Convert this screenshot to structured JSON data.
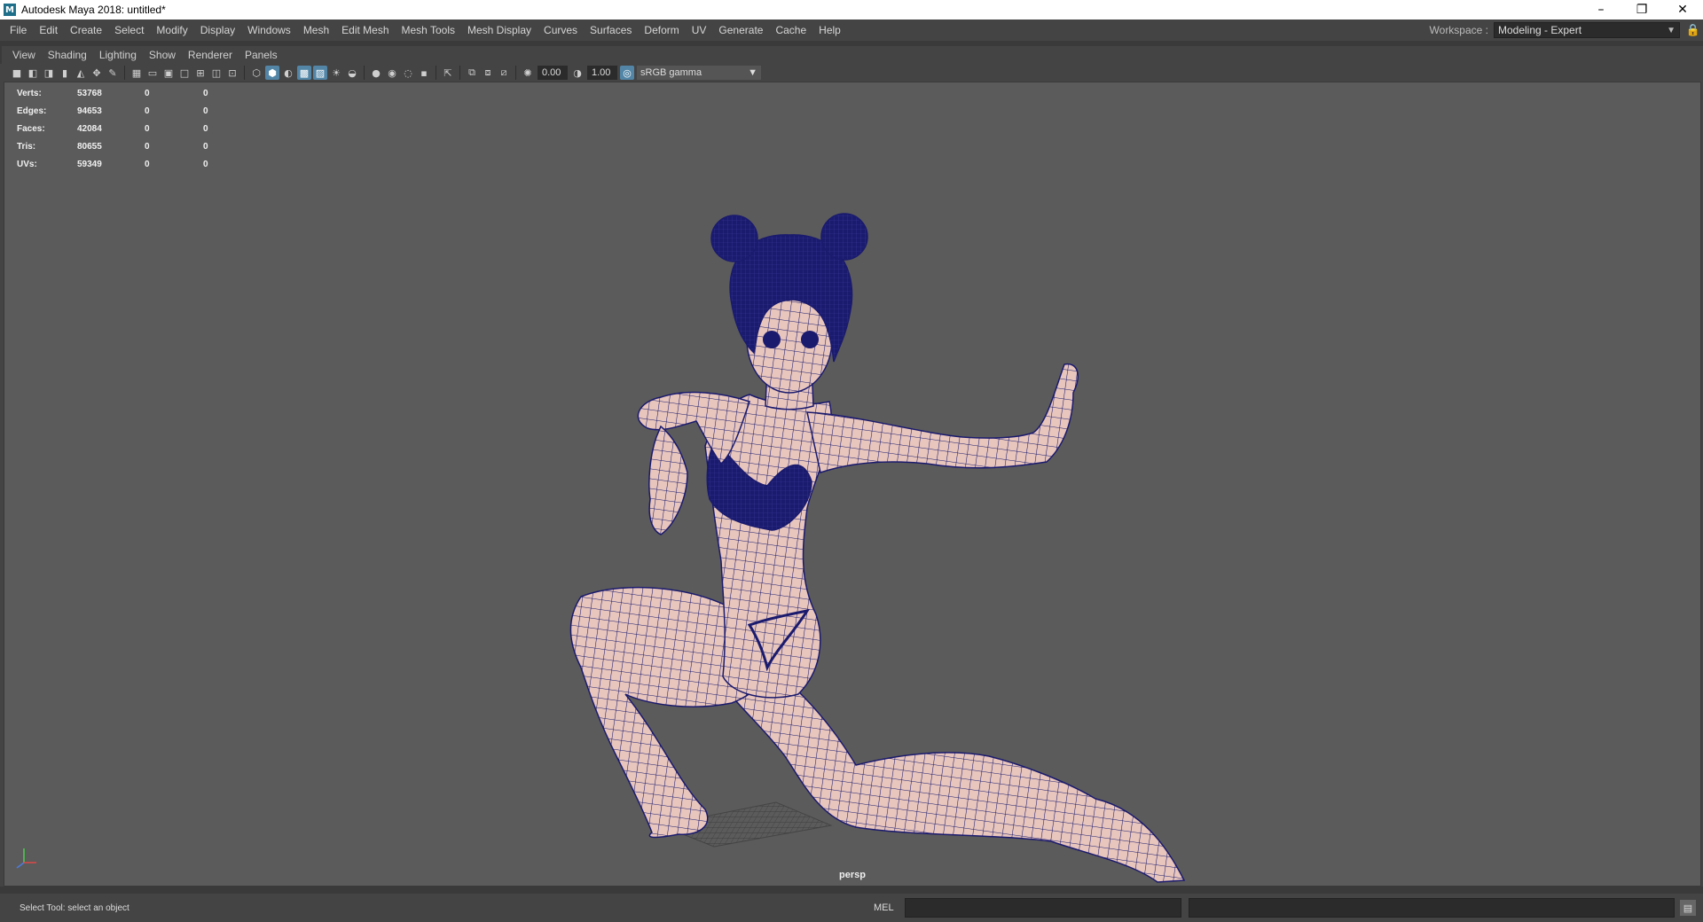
{
  "window": {
    "title": "Autodesk Maya 2018: untitled*",
    "app_icon": "M"
  },
  "menu": [
    "File",
    "Edit",
    "Create",
    "Select",
    "Modify",
    "Display",
    "Windows",
    "Mesh",
    "Edit Mesh",
    "Mesh Tools",
    "Mesh Display",
    "Curves",
    "Surfaces",
    "Deform",
    "UV",
    "Generate",
    "Cache",
    "Help"
  ],
  "workspace": {
    "label": "Workspace :",
    "value": "Modeling - Expert"
  },
  "panel_menu": [
    "View",
    "Shading",
    "Lighting",
    "Show",
    "Renderer",
    "Panels"
  ],
  "toolbar": {
    "exposure": "0.00",
    "gamma": "1.00",
    "color_space": "sRGB gamma"
  },
  "hud": {
    "rows": [
      {
        "label": "Verts:",
        "v1": "53768",
        "v2": "0",
        "v3": "0"
      },
      {
        "label": "Edges:",
        "v1": "94653",
        "v2": "0",
        "v3": "0"
      },
      {
        "label": "Faces:",
        "v1": "42084",
        "v2": "0",
        "v3": "0"
      },
      {
        "label": "Tris:",
        "v1": "80655",
        "v2": "0",
        "v3": "0"
      },
      {
        "label": "UVs:",
        "v1": "59349",
        "v2": "0",
        "v3": "0"
      }
    ]
  },
  "viewport": {
    "camera_label": "persp",
    "mesh_fill": "#e8c6bd",
    "wire_color": "#1a1a6e"
  },
  "status": {
    "help_line": "Select Tool: select an object",
    "mel_label": "MEL"
  }
}
